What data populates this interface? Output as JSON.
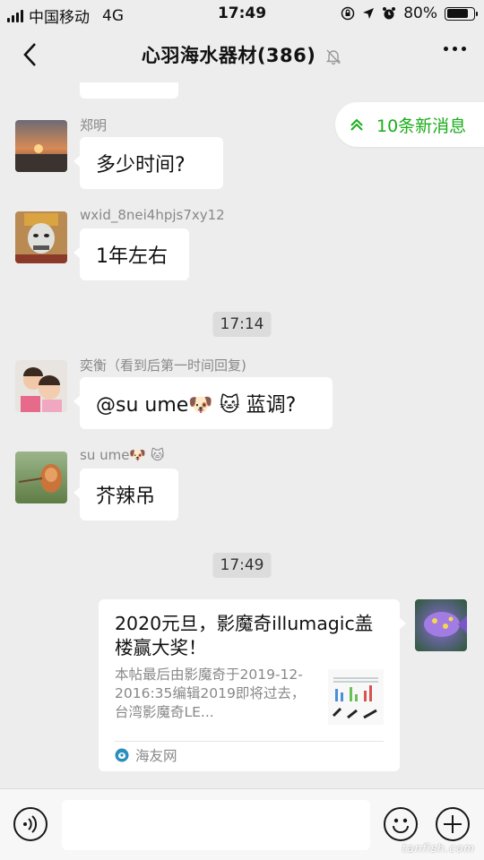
{
  "status_bar": {
    "carrier": "中国移动",
    "network": "4G",
    "time": "17:49",
    "battery_percent": "80%",
    "battery_level": 0.8
  },
  "nav": {
    "title": "心羽海水器材(386)",
    "icons": [
      "back-chevron-icon",
      "mute-bell-icon",
      "more-dots-icon"
    ]
  },
  "new_messages_label": "10条新消息",
  "messages": [
    {
      "sender": "郑明",
      "text": "多少时间?"
    },
    {
      "sender": "wxid_8nei4hpjs7xy12",
      "text": "1年左右"
    },
    {
      "sender": "奕衡（看到后第一时间回复)",
      "text": "@su ume🐶 🐱 蓝调?"
    },
    {
      "sender": "su ume🐶 🐱",
      "text": "芥辣吊"
    }
  ],
  "timestamps": [
    "17:14",
    "17:49"
  ],
  "link_card": {
    "title": "2020元旦，影魔奇illumagic盖楼赢大奖！",
    "description": "本帖最后由影魔奇于2019-12-2016:35编辑2019即将过去，台湾影魔奇LE...",
    "source": "海友网"
  },
  "watermark": "tanfish.com",
  "colors": {
    "background": "#ededed",
    "bubble": "#ffffff",
    "accent_green": "#1aad19",
    "timestamp_pill": "#dcdcdc"
  }
}
